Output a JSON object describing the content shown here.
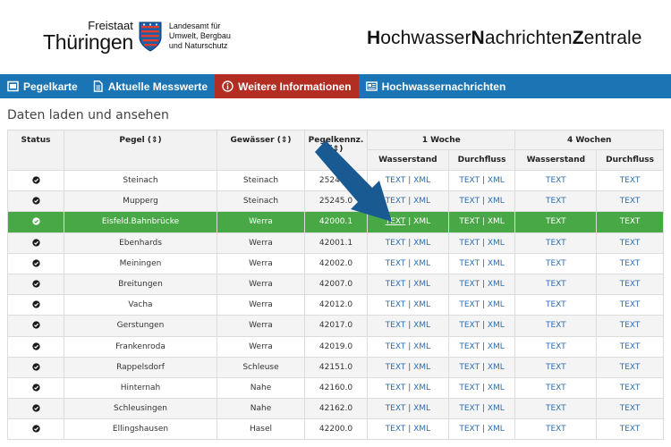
{
  "header": {
    "logo_line1": "Freistaat",
    "logo_line2": "Thüringen",
    "agency_lines": [
      "Landesamt für",
      "Umwelt, Bergbau",
      "und Naturschutz"
    ],
    "brand_parts": [
      {
        "cap": "H",
        "rest": "ochwasser"
      },
      {
        "cap": "N",
        "rest": "achrichten"
      },
      {
        "cap": "Z",
        "rest": "entrale"
      }
    ]
  },
  "nav": [
    {
      "label": "Pegelkarte",
      "icon": "map-icon",
      "active": false
    },
    {
      "label": "Aktuelle Messwerte",
      "icon": "document-icon",
      "active": false
    },
    {
      "label": "Weitere Informationen",
      "icon": "info-icon",
      "active": true
    },
    {
      "label": "Hochwassernachrichten",
      "icon": "news-icon",
      "active": false
    }
  ],
  "section_title": "Daten laden und ansehen",
  "table": {
    "headers": {
      "status": "Status",
      "pegel": "Pegel (⇕)",
      "gewaesser": "Gewässer (⇕)",
      "pegelkennz": "Pegelkennz. (⇕)",
      "week1": "1 Woche",
      "week4": "4 Wochen",
      "wasserstand": "Wasserstand",
      "durchfluss": "Durchfluss"
    },
    "link_text": "TEXT",
    "link_xml": "XML",
    "separator": " | ",
    "rows": [
      {
        "pegel": "Steinach",
        "gewaesser": "Steinach",
        "nr": "25240.1",
        "highlight": false
      },
      {
        "pegel": "Mupperg",
        "gewaesser": "Steinach",
        "nr": "25245.0",
        "highlight": false
      },
      {
        "pegel": "Eisfeld.Bahnbrücke",
        "gewaesser": "Werra",
        "nr": "42000.1",
        "highlight": true
      },
      {
        "pegel": "Ebenhards",
        "gewaesser": "Werra",
        "nr": "42001.1",
        "highlight": false
      },
      {
        "pegel": "Meiningen",
        "gewaesser": "Werra",
        "nr": "42002.0",
        "highlight": false
      },
      {
        "pegel": "Breitungen",
        "gewaesser": "Werra",
        "nr": "42007.0",
        "highlight": false
      },
      {
        "pegel": "Vacha",
        "gewaesser": "Werra",
        "nr": "42012.0",
        "highlight": false
      },
      {
        "pegel": "Gerstungen",
        "gewaesser": "Werra",
        "nr": "42017.0",
        "highlight": false
      },
      {
        "pegel": "Frankenroda",
        "gewaesser": "Werra",
        "nr": "42019.0",
        "highlight": false
      },
      {
        "pegel": "Rappelsdorf",
        "gewaesser": "Schleuse",
        "nr": "42151.0",
        "highlight": false
      },
      {
        "pegel": "Hinternah",
        "gewaesser": "Nahe",
        "nr": "42160.0",
        "highlight": false
      },
      {
        "pegel": "Schleusingen",
        "gewaesser": "Nahe",
        "nr": "42162.0",
        "highlight": false
      },
      {
        "pegel": "Ellingshausen",
        "gewaesser": "Hasel",
        "nr": "42200.0",
        "highlight": false
      }
    ]
  },
  "colors": {
    "nav_bg": "#1b75b4",
    "nav_active": "#b22d22",
    "row_highlight": "#49a846",
    "link": "#2e6db0",
    "arrow": "#1a5a93"
  }
}
